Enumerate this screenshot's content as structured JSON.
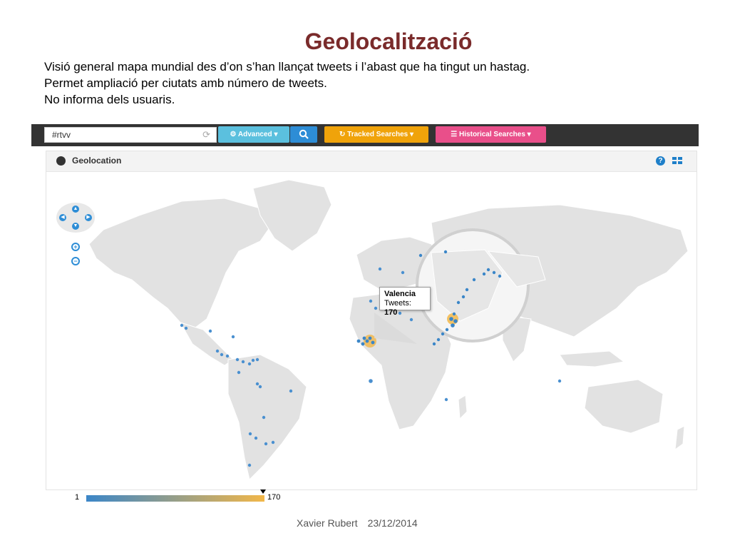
{
  "slide": {
    "title": "Geolocalització",
    "bullets": [
      "Visió general mapa mundial des d’on s’han llançat tweets i l’abast que ha tingut un hastag.",
      "Permet ampliació per ciutats amb número de tweets.",
      "No informa dels usuaris."
    ],
    "footer": {
      "author": "Xavier Rubert",
      "date": "23/12/2014"
    }
  },
  "toolbar": {
    "search_value": "#rtvv",
    "advanced_label": "Advanced",
    "tracked_label": "Tracked Searches",
    "historical_label": "Historical Searches",
    "colors": {
      "topbar": "#333333",
      "advanced": "#5bc0de",
      "search": "#2d8dd6",
      "tracked": "#f0a30a",
      "historical": "#e94f8a"
    }
  },
  "panel": {
    "title": "Geolocation",
    "icons": [
      "globe-icon",
      "help-icon",
      "grid-view-icon"
    ]
  },
  "map": {
    "controls": [
      "pan-up",
      "pan-left",
      "pan-right",
      "pan-down",
      "zoom-in",
      "zoom-out"
    ],
    "tooltip": {
      "city": "Valencia",
      "label": "Tweets:",
      "count": "170"
    },
    "legend": {
      "min": "1",
      "max": "170",
      "min_color": "#3b86c8",
      "max_color": "#f2b749"
    }
  }
}
